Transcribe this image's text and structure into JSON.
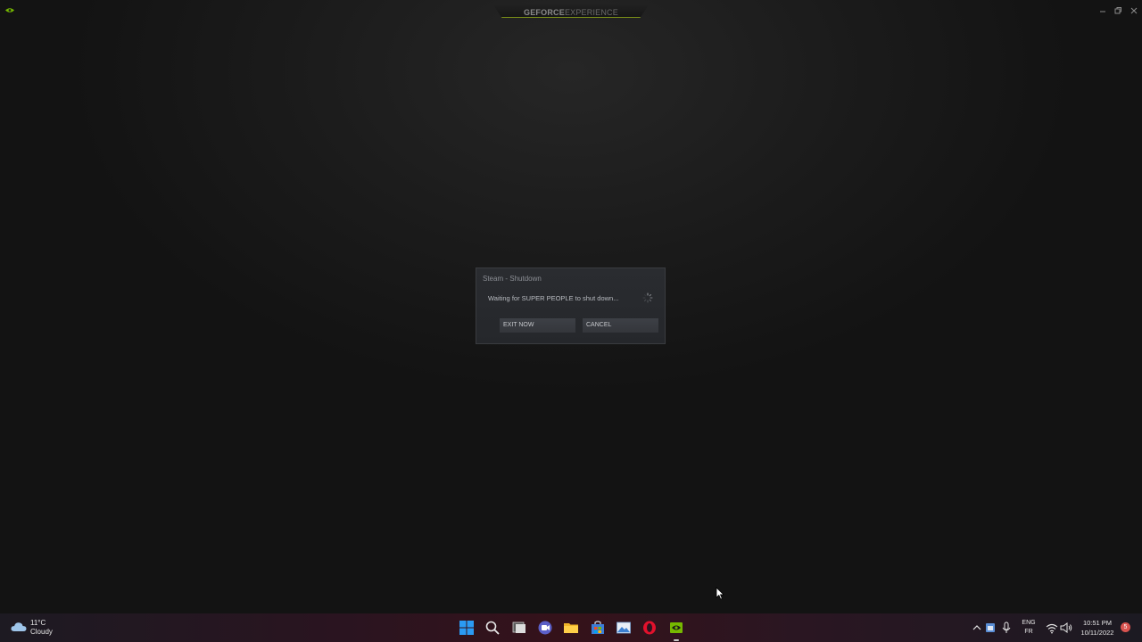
{
  "app": {
    "brand_bold": "GEFORCE",
    "brand_light": "EXPERIENCE",
    "accent_color": "#76b900",
    "window_controls": [
      "minimize-icon",
      "restore-icon",
      "close-icon"
    ]
  },
  "dialog": {
    "title": "Steam - Shutdown",
    "message": "Waiting for SUPER PEOPLE to shut down...",
    "exit_label": "EXIT NOW",
    "cancel_label": "CANCEL",
    "spinner_icon": "loading-spinner-icon"
  },
  "taskbar": {
    "weather": {
      "temperature": "11°C",
      "condition": "Cloudy",
      "icon": "cloud-icon"
    },
    "apps": [
      "windows-start-icon",
      "search-icon",
      "task-view-icon",
      "teams-chat-icon",
      "file-explorer-icon",
      "microsoft-store-icon",
      "photos-icon",
      "opera-icon",
      "geforce-experience-icon"
    ],
    "tray": {
      "language": "ENG",
      "keyboard_layout": "FR",
      "time": "10:51 PM",
      "date": "10/11/2022",
      "notification_count": "5"
    }
  }
}
